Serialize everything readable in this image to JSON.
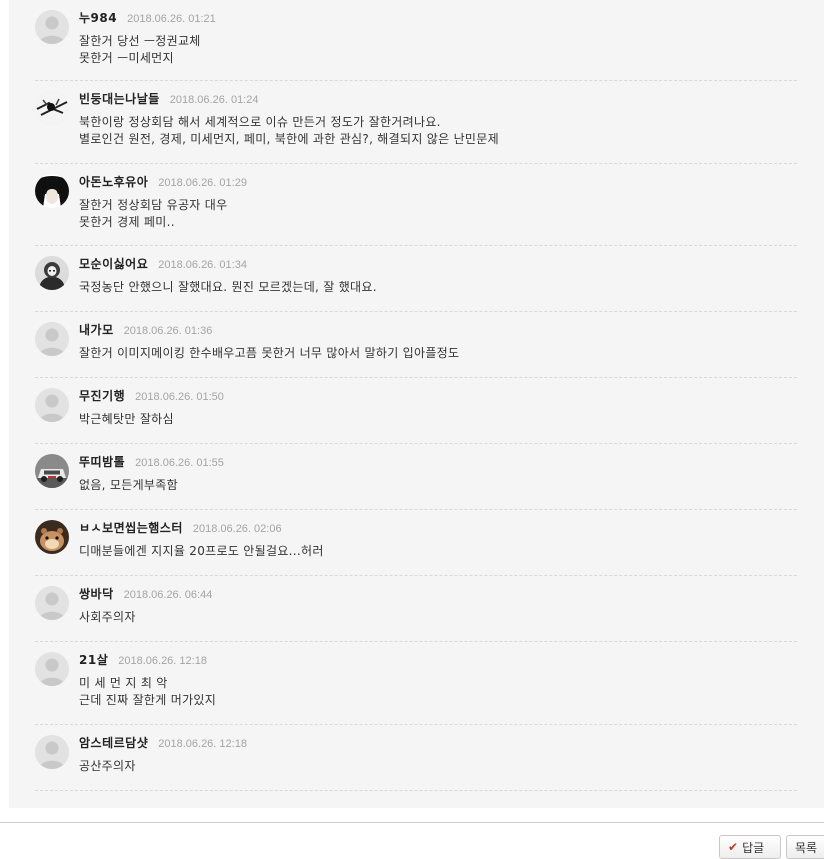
{
  "comments": [
    {
      "nickname": "누984",
      "date": "2018.06.26. 01:21",
      "lines": [
        "잘한거 당선 ㅡ정권교체",
        "못한거 ㅡ미세먼지"
      ],
      "avatar": "default-avatar-icon"
    },
    {
      "nickname": "빈둥대는나날들",
      "date": "2018.06.26. 01:24",
      "lines": [
        "북한이랑 정상회담 해서 세계적으로 이슈 만든거 정도가 잘한거려나요.",
        "별로인건 원전, 경제, 미세먼지, 페미, 북한에 과한 관심?, 해결되지 않은 난민문제"
      ],
      "avatar": "sketch-avatar-icon"
    },
    {
      "nickname": "아돈노후유아",
      "date": "2018.06.26. 01:29",
      "lines": [
        "잘한거 정상회담 유공자 대우",
        "못한거 경제 페미.."
      ],
      "avatar": "dark-hair-avatar-icon"
    },
    {
      "nickname": "모순이싫어요",
      "date": "2018.06.26. 01:34",
      "lines": [
        "국정농단 안했으니 잘했대요. 뭔진 모르겠는데, 잘 했대요."
      ],
      "avatar": "hooded-figure-avatar-icon"
    },
    {
      "nickname": "내가모",
      "date": "2018.06.26. 01:36",
      "lines": [
        "잘한거 이미지메이킹 한수배우고픔 못한거 너무 많아서 말하기 입아플정도"
      ],
      "avatar": "default-avatar-icon"
    },
    {
      "nickname": "무진기행",
      "date": "2018.06.26. 01:50",
      "lines": [
        "박근혜탓만 잘하심"
      ],
      "avatar": "default-avatar-icon"
    },
    {
      "nickname": "뚜띠밤톨",
      "date": "2018.06.26. 01:55",
      "lines": [
        "없음, 모든게부족함"
      ],
      "avatar": "car-avatar-icon"
    },
    {
      "nickname": "ㅂㅅ보면씹는햄스터",
      "date": "2018.06.26. 02:06",
      "lines": [
        "디매분들에겐 지지율 20프로도 안될걸요...허러"
      ],
      "avatar": "hamster-avatar-icon"
    },
    {
      "nickname": "쌍바닥",
      "date": "2018.06.26. 06:44",
      "lines": [
        "사회주의자"
      ],
      "avatar": "default-avatar-icon"
    },
    {
      "nickname": "21살",
      "date": "2018.06.26. 12:18",
      "lines": [
        "미 세 먼 지 최 악",
        "근데 진짜 잘한게 머가있지"
      ],
      "avatar": "default-avatar-icon"
    },
    {
      "nickname": "암스테르담샷",
      "date": "2018.06.26. 12:18",
      "lines": [
        "공산주의자"
      ],
      "avatar": "default-avatar-icon"
    }
  ],
  "buttons": {
    "reply_label": "답글",
    "list_label": "목록"
  },
  "colors": {
    "panel_bg": "#f5f5f5",
    "date_text": "#a4a4a4",
    "check_mark": "#c0392b"
  }
}
